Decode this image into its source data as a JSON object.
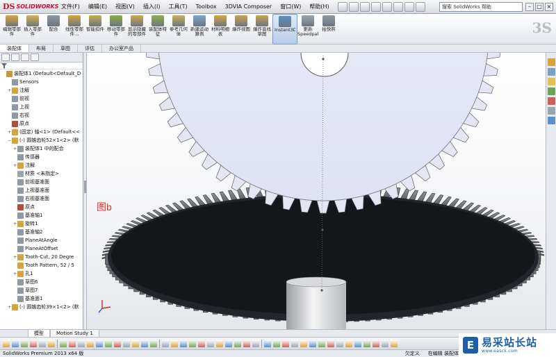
{
  "titlebar": {
    "brand_ds": "DS",
    "brand_name": "SOLIDWORKS",
    "menu": [
      "文件(F)",
      "编辑(E)",
      "视图(V)",
      "插入(I)",
      "工具(T)",
      "Toolbox",
      "3DVIA Composer",
      "窗口(W)",
      "帮助(H)"
    ],
    "search_placeholder": "搜索 SolidWorks 帮助",
    "window_controls": [
      "–",
      "□",
      "×"
    ]
  },
  "command_manager": {
    "items": [
      {
        "label": "编辑零部件",
        "color": "#e0a33a"
      },
      {
        "label": "插入零部件",
        "color": "#d9b24a"
      },
      {
        "label": "配合",
        "color": "#8f98a3"
      },
      {
        "label": "线性零部件...",
        "color": "#d3a43c"
      },
      {
        "label": "智能扣件",
        "color": "#c9b04a"
      },
      {
        "label": "移动零部件",
        "color": "#8bb04a"
      },
      {
        "label": "显示隐藏的零部件",
        "color": "#d0a84a"
      },
      {
        "label": "装配体特征",
        "color": "#8fb04a"
      },
      {
        "label": "参考几何体",
        "color": "#c7b45a"
      },
      {
        "label": "新建运动算例",
        "color": "#79a6cf"
      },
      {
        "label": "材料明细表",
        "color": "#d8a43c"
      },
      {
        "label": "爆炸视图",
        "color": "#d0a050"
      },
      {
        "label": "爆炸直线草图",
        "color": "#c8a44c"
      },
      {
        "label": "Instant3D",
        "color": "#5a8fc9",
        "active": true
      },
      {
        "label": "更新 Speedpak",
        "color": "#9aa4b1"
      },
      {
        "label": "拍快照",
        "color": "#8d9aa8"
      }
    ],
    "tabs": [
      "装配体",
      "布局",
      "草图",
      "评估",
      "办公室产品"
    ]
  },
  "feature_tree": {
    "filter_icon": "funnel-icon",
    "rows": [
      {
        "label": "装配体1 (Default<Default_D",
        "indent": 0,
        "expand": "",
        "icon": "#c59a3a"
      },
      {
        "label": "Sensors",
        "indent": 1,
        "expand": "",
        "icon": "#8f98a3"
      },
      {
        "label": "注解",
        "indent": 1,
        "expand": "+",
        "icon": "#d6a33e"
      },
      {
        "label": "前视",
        "indent": 1,
        "expand": "",
        "icon": "#8f98a3"
      },
      {
        "label": "上视",
        "indent": 1,
        "expand": "",
        "icon": "#8f98a3"
      },
      {
        "label": "右视",
        "indent": 1,
        "expand": "",
        "icon": "#8f98a3"
      },
      {
        "label": "原点",
        "indent": 1,
        "expand": "",
        "icon": "#b84a3a"
      },
      {
        "label": "(固定) 轴<1> (Default<<",
        "indent": 1,
        "expand": "+",
        "icon": "#d6a33e"
      },
      {
        "label": "(-) 圆锥齿轮52×1<2> (默",
        "indent": 1,
        "expand": "−",
        "icon": "#d6a33e"
      },
      {
        "label": "装配体1 中的配合",
        "indent": 2,
        "expand": "+",
        "icon": "#8f98a3"
      },
      {
        "label": "传感器",
        "indent": 2,
        "expand": "",
        "icon": "#8f98a3"
      },
      {
        "label": "注解",
        "indent": 2,
        "expand": "+",
        "icon": "#d6a33e"
      },
      {
        "label": "材质 <未指定>",
        "indent": 2,
        "expand": "",
        "icon": "#9aa4b1"
      },
      {
        "label": "前视基准面",
        "indent": 2,
        "expand": "",
        "icon": "#8f98a3"
      },
      {
        "label": "上视基准面",
        "indent": 2,
        "expand": "",
        "icon": "#8f98a3"
      },
      {
        "label": "右视基准面",
        "indent": 2,
        "expand": "",
        "icon": "#8f98a3"
      },
      {
        "label": "原点",
        "indent": 2,
        "expand": "",
        "icon": "#b84a3a"
      },
      {
        "label": "基准轴1",
        "indent": 2,
        "expand": "",
        "icon": "#8f98a3"
      },
      {
        "label": "旋转1",
        "indent": 2,
        "expand": "+",
        "icon": "#d6a33e"
      },
      {
        "label": "基准轴2",
        "indent": 2,
        "expand": "",
        "icon": "#8f98a3"
      },
      {
        "label": "PlaneAtAngle",
        "indent": 2,
        "expand": "",
        "icon": "#8f98a3"
      },
      {
        "label": "PlaneAtOffset",
        "indent": 2,
        "expand": "",
        "icon": "#8f98a3"
      },
      {
        "label": "Tooth-Cut, 20 Degre",
        "indent": 2,
        "expand": "+",
        "icon": "#d6a33e"
      },
      {
        "label": "Tooth Pattern, 52 / 5",
        "indent": 2,
        "expand": "",
        "icon": "#d6a33e"
      },
      {
        "label": "孔1",
        "indent": 2,
        "expand": "+",
        "icon": "#d6a33e"
      },
      {
        "label": "草图6",
        "indent": 2,
        "expand": "",
        "icon": "#8f98a3"
      },
      {
        "label": "草图7",
        "indent": 2,
        "expand": "",
        "icon": "#8f98a3"
      },
      {
        "label": "基准面1",
        "indent": 2,
        "expand": "",
        "icon": "#8f98a3"
      },
      {
        "label": "(-) 圆锥齿轮39×1<2> (默",
        "indent": 1,
        "expand": "+",
        "icon": "#d6a33e"
      }
    ]
  },
  "viewport": {
    "figure_label": "图b"
  },
  "model_tabs": [
    "模型",
    "Motion Study 1"
  ],
  "status": {
    "left": "SolidWorks Premium 2013 x64 版",
    "right": [
      "欠定义",
      "在编辑 装配体"
    ]
  },
  "watermark": {
    "logo": "E",
    "name": "易采站长站",
    "url": "www.easck.com"
  }
}
